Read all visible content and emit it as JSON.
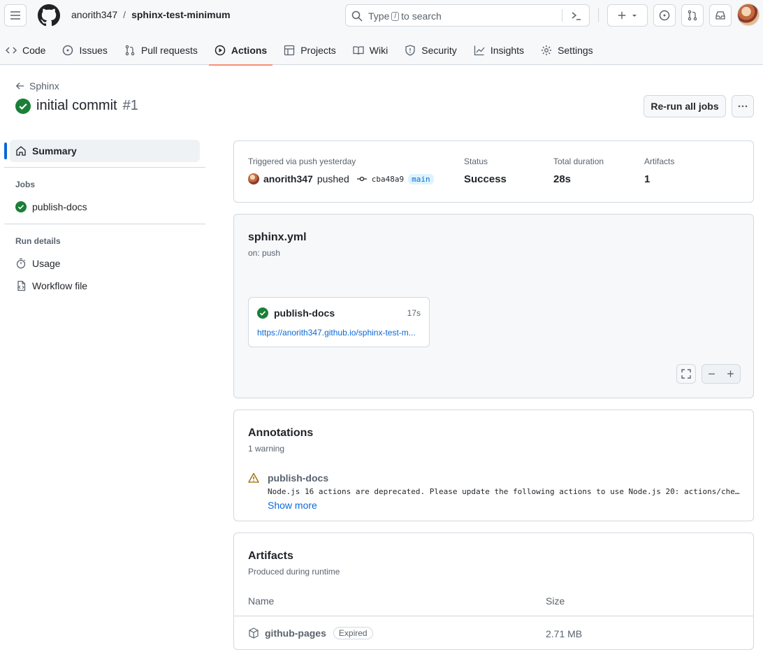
{
  "header": {
    "owner": "anorith347",
    "separator": "/",
    "repo": "sphinx-test-minimum",
    "search": {
      "text_before": "Type",
      "key": "/",
      "text_after": "to search"
    }
  },
  "nav": {
    "tabs": [
      {
        "label": "Code",
        "icon": "code-icon"
      },
      {
        "label": "Issues",
        "icon": "issue-icon"
      },
      {
        "label": "Pull requests",
        "icon": "pull-request-icon"
      },
      {
        "label": "Actions",
        "icon": "play-icon",
        "active": true
      },
      {
        "label": "Projects",
        "icon": "table-icon"
      },
      {
        "label": "Wiki",
        "icon": "book-icon"
      },
      {
        "label": "Security",
        "icon": "shield-icon"
      },
      {
        "label": "Insights",
        "icon": "graph-icon"
      },
      {
        "label": "Settings",
        "icon": "gear-icon"
      }
    ]
  },
  "run": {
    "back_label": "Sphinx",
    "title": "initial commit",
    "number": "#1",
    "rerun_label": "Re-run all jobs"
  },
  "sidebar": {
    "summary_label": "Summary",
    "jobs_heading": "Jobs",
    "jobs": [
      {
        "label": "publish-docs",
        "status": "success"
      }
    ],
    "details_heading": "Run details",
    "details": [
      {
        "label": "Usage",
        "icon": "stopwatch-icon"
      },
      {
        "label": "Workflow file",
        "icon": "file-code-icon"
      }
    ]
  },
  "summary": {
    "trigger_label": "Triggered via push yesterday",
    "actor": "anorith347",
    "action": "pushed",
    "commit": "cba48a9",
    "branch": "main",
    "status_label": "Status",
    "status_value": "Success",
    "duration_label": "Total duration",
    "duration_value": "28s",
    "artifacts_label": "Artifacts",
    "artifacts_value": "1"
  },
  "workflow": {
    "file": "sphinx.yml",
    "trigger": "on: push",
    "job_name": "publish-docs",
    "job_time": "17s",
    "job_url": "https://anorith347.github.io/sphinx-test-m..."
  },
  "annotations": {
    "title": "Annotations",
    "count": "1 warning",
    "items": [
      {
        "job": "publish-docs",
        "message": "Node.js 16 actions are deprecated. Please update the following actions to use Node.js 20: actions/che…",
        "more_label": "Show more"
      }
    ]
  },
  "artifacts": {
    "title": "Artifacts",
    "subtitle": "Produced during runtime",
    "columns": [
      "Name",
      "Size"
    ],
    "rows": [
      {
        "name": "github-pages",
        "badge": "Expired",
        "size": "2.71 MB"
      }
    ]
  },
  "colors": {
    "success": "#1a7f37",
    "link": "#0969da",
    "accent_underline": "#fd8c73",
    "warning": "#9a6700"
  }
}
